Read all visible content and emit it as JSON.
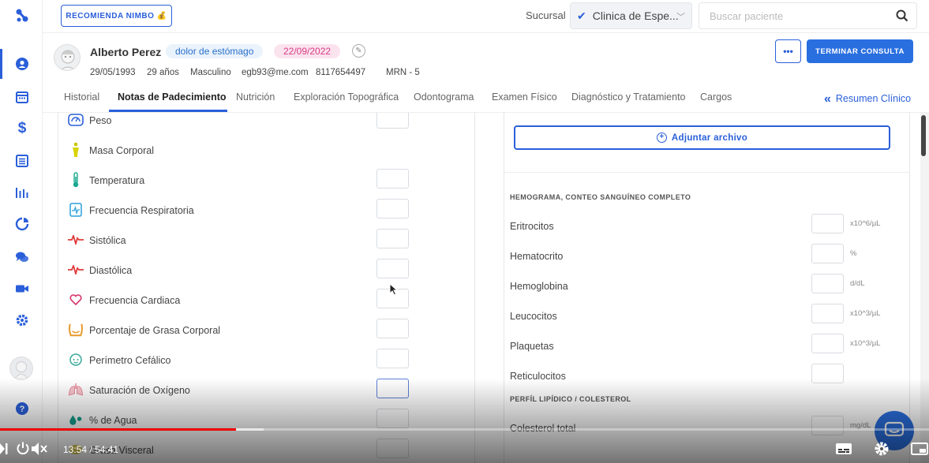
{
  "topbar": {
    "recommend_label": "RECOMIENDA NIMBO 💰",
    "sucursal_label": "Sucursal",
    "sucursal_value": "Clinica de Espe...",
    "search_placeholder": "Buscar paciente"
  },
  "patient": {
    "name": "Alberto Perez",
    "reason": "dolor de estómago",
    "date": "22/09/2022",
    "birthdate": "29/05/1993",
    "age": "29 años",
    "sex": "Masculino",
    "email": "egb93@me.com",
    "phone": "8117654497",
    "mrn": "MRN - 5",
    "more_label": "•••",
    "end_label": "TERMINAR CONSULTA"
  },
  "tabs": [
    "Historial",
    "Notas de Padecimiento",
    "Nutrición",
    "Exploración Topográfica",
    "Odontograma",
    "Examen Físico",
    "Diagnóstico y Tratamiento",
    "Cargos"
  ],
  "resumen_label": "Resumen Clínico",
  "vitals": [
    {
      "label": "Peso",
      "icon": "scale-icon"
    },
    {
      "label": "Masa Corporal",
      "icon": "body-mass-icon"
    },
    {
      "label": "Temperatura",
      "icon": "thermometer-icon"
    },
    {
      "label": "Frecuencia Respiratoria",
      "icon": "respiratory-icon"
    },
    {
      "label": "Sistólica",
      "icon": "pulse-icon"
    },
    {
      "label": "Diastólica",
      "icon": "pulse-icon"
    },
    {
      "label": "Frecuencia Cardiaca",
      "icon": "heart-icon"
    },
    {
      "label": "Porcentaje de Grasa Corporal",
      "icon": "body-fat-icon"
    },
    {
      "label": "Perímetro Cefálico",
      "icon": "head-icon"
    },
    {
      "label": "Saturación de Oxígeno",
      "icon": "lungs-icon"
    },
    {
      "label": "% de Agua",
      "icon": "water-drop-icon"
    },
    {
      "label": "Grasa Visceral",
      "icon": "visceral-fat-icon"
    }
  ],
  "attach_label": "Adjuntar archivo",
  "hemograma": {
    "title": "HEMOGRAMA, CONTEO SANGUÍNEO COMPLETO",
    "rows": [
      {
        "label": "Eritrocitos",
        "unit": "x10^6/µL"
      },
      {
        "label": "Hematocrito",
        "unit": "%"
      },
      {
        "label": "Hemoglobina",
        "unit": "d/dL"
      },
      {
        "label": "Leucocitos",
        "unit": "x10^3/µL"
      },
      {
        "label": "Plaquetas",
        "unit": "x10^3/µL"
      },
      {
        "label": "Reticulocitos",
        "unit": ""
      }
    ]
  },
  "lipidos": {
    "title": "PERFÍL LIPÍDICO / COLESTEROL",
    "rows": [
      {
        "label": "Colesterol total",
        "unit": "mg/dL"
      }
    ]
  },
  "video": {
    "time": "13:54 / 54:41",
    "played_fraction": 0.254,
    "buffered_fraction": 0.284
  },
  "colors": {
    "accent": "#2a5fd9",
    "progress": "#ee0000"
  }
}
